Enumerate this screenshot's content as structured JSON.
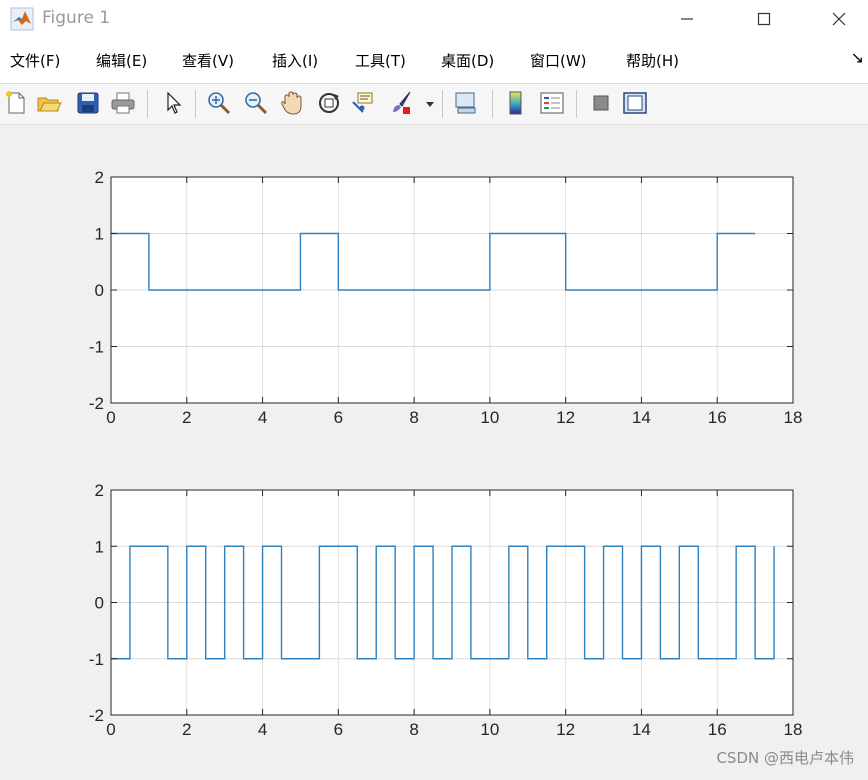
{
  "window": {
    "title": "Figure 1",
    "controls": [
      "minimize",
      "maximize",
      "close"
    ]
  },
  "menu": {
    "items": [
      {
        "label": "文件(F)"
      },
      {
        "label": "编辑(E)"
      },
      {
        "label": "查看(V)"
      },
      {
        "label": "插入(I)"
      },
      {
        "label": "工具(T)"
      },
      {
        "label": "桌面(D)"
      },
      {
        "label": "窗口(W)"
      },
      {
        "label": "帮助(H)"
      }
    ],
    "overflow_glyph": "↘"
  },
  "toolbar": {
    "buttons": [
      "new-figure-icon",
      "open-file-icon",
      "save-icon",
      "print-icon",
      "edit-plot-cursor-icon",
      "zoom-in-icon",
      "zoom-out-icon",
      "pan-hand-icon",
      "rotate-3d-icon",
      "data-cursor-icon",
      "brush-icon",
      "brush-dropdown-icon",
      "link-plot-icon",
      "insert-colorbar-icon",
      "insert-legend-icon",
      "hide-plot-tools-icon",
      "show-plot-tools-icon"
    ]
  },
  "watermark": "CSDN @西电卢本伟",
  "colors": {
    "line": "#2f82c0",
    "axes": "#262626",
    "grid": "#dcdcdc",
    "tick_text": "#262626"
  },
  "chart_data": [
    {
      "type": "line",
      "step": true,
      "xlim": [
        0,
        18
      ],
      "ylim": [
        -2,
        2
      ],
      "xticks": [
        0,
        2,
        4,
        6,
        8,
        10,
        12,
        14,
        16,
        18
      ],
      "yticks": [
        -2,
        -1,
        0,
        1,
        2
      ],
      "grid": true,
      "series": [
        {
          "x": [
            0,
            1,
            1,
            5,
            5,
            6,
            6,
            10,
            10,
            12,
            12,
            16,
            16,
            17
          ],
          "y": [
            1,
            1,
            0,
            0,
            1,
            1,
            0,
            0,
            1,
            1,
            0,
            0,
            1,
            1
          ]
        }
      ]
    },
    {
      "type": "line",
      "step": true,
      "xlim": [
        0,
        18
      ],
      "ylim": [
        -2,
        2
      ],
      "xticks": [
        0,
        2,
        4,
        6,
        8,
        10,
        12,
        14,
        16,
        18
      ],
      "yticks": [
        -2,
        -1,
        0,
        1,
        2
      ],
      "grid": true,
      "series": [
        {
          "x": [
            0,
            0.5,
            0.5,
            1.5,
            1.5,
            2,
            2,
            2.5,
            2.5,
            3,
            3,
            3.5,
            3.5,
            4,
            4,
            4.5,
            4.5,
            5.5,
            5.5,
            6.5,
            6.5,
            7,
            7,
            7.5,
            7.5,
            8,
            8,
            8.5,
            8.5,
            9,
            9,
            9.5,
            9.5,
            10.5,
            10.5,
            11,
            11,
            11.5,
            11.5,
            12.5,
            12.5,
            13,
            13,
            13.5,
            13.5,
            14,
            14,
            14.5,
            14.5,
            15,
            15,
            15.5,
            15.5,
            16.5,
            16.5,
            17,
            17,
            17.5,
            17.5
          ],
          "y": [
            -1,
            -1,
            1,
            1,
            -1,
            -1,
            1,
            1,
            -1,
            -1,
            1,
            1,
            -1,
            -1,
            1,
            1,
            -1,
            -1,
            1,
            1,
            -1,
            -1,
            1,
            1,
            -1,
            -1,
            1,
            1,
            -1,
            -1,
            1,
            1,
            -1,
            -1,
            1,
            1,
            -1,
            -1,
            1,
            1,
            -1,
            -1,
            1,
            1,
            -1,
            -1,
            1,
            1,
            -1,
            -1,
            1,
            1,
            -1,
            -1,
            1,
            1,
            -1,
            -1,
            1
          ]
        }
      ]
    }
  ]
}
